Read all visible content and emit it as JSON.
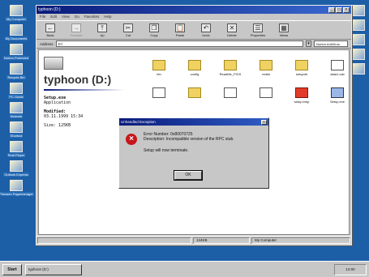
{
  "desktop": {
    "left_icons": [
      {
        "label": "My Computer",
        "icon": "computer-icon"
      },
      {
        "label": "My Documents",
        "icon": "documents-icon"
      },
      {
        "label": "Norton Protected",
        "icon": "norton-icon"
      },
      {
        "label": "Recycle Bin",
        "icon": "recycle-bin-icon"
      },
      {
        "label": "PC Guide",
        "icon": "guide-icon"
      },
      {
        "label": "Network",
        "icon": "network-icon"
      },
      {
        "label": "Shortcut",
        "icon": "shortcut-icon"
      },
      {
        "label": "Real Player",
        "icon": "player-icon"
      },
      {
        "label": "Outlook Express",
        "icon": "mail-icon"
      },
      {
        "label": "Pinnacle Pagemanager",
        "icon": "pagemanager-icon"
      }
    ],
    "right_icons": [
      {
        "label": "",
        "icon": "app-icon"
      },
      {
        "label": "",
        "icon": "app-icon"
      },
      {
        "label": "",
        "icon": "app-icon"
      },
      {
        "label": "",
        "icon": "app-icon"
      },
      {
        "label": "",
        "icon": "app-icon"
      }
    ]
  },
  "window": {
    "title": "typhoon (D:)",
    "menu": [
      "File",
      "Edit",
      "View",
      "Go",
      "Favorites",
      "Help"
    ],
    "toolbar": [
      {
        "label": "Back",
        "glyph": "←",
        "icon": "back-arrow-icon",
        "enabled": true
      },
      {
        "label": "Forward",
        "glyph": "→",
        "icon": "forward-arrow-icon",
        "enabled": false
      },
      {
        "label": "Up",
        "glyph": "⤒",
        "icon": "up-folder-icon",
        "enabled": true
      },
      {
        "label": "Cut",
        "glyph": "✂",
        "icon": "scissors-icon",
        "enabled": true
      },
      {
        "label": "Copy",
        "glyph": "❐",
        "icon": "copy-icon",
        "enabled": true
      },
      {
        "label": "Paste",
        "glyph": "📋",
        "icon": "paste-icon",
        "enabled": true
      },
      {
        "label": "Undo",
        "glyph": "↶",
        "icon": "undo-icon",
        "enabled": true
      },
      {
        "label": "Delete",
        "glyph": "✕",
        "icon": "delete-icon",
        "enabled": true
      },
      {
        "label": "Properties",
        "glyph": "☰",
        "icon": "properties-icon",
        "enabled": true
      },
      {
        "label": "Views",
        "glyph": "▦",
        "icon": "views-icon",
        "enabled": true
      }
    ],
    "address": {
      "label": "Address",
      "value": "D:\\",
      "extra": "Norton AntiVirus"
    },
    "webview": {
      "drive_title": "typhoon (D:)",
      "file_name": "Setup.exe",
      "file_type": "Application",
      "modified_label": "Modified:",
      "modified_value": "03.11.1999 15:34",
      "size_label": "Size: 125KB"
    },
    "files": [
      {
        "label": "bin",
        "kind": "folder"
      },
      {
        "label": "config",
        "kind": "folder"
      },
      {
        "label": "ReadMe_FIGS",
        "kind": "folder"
      },
      {
        "label": "redist",
        "kind": "folder"
      },
      {
        "label": "setupdir",
        "kind": "folder"
      },
      {
        "label": "data1.cab",
        "kind": "doc"
      },
      {
        "label": "",
        "kind": "doc"
      },
      {
        "label": "",
        "kind": "folder"
      },
      {
        "label": "",
        "kind": "doc"
      },
      {
        "label": "",
        "kind": "doc"
      },
      {
        "label": "setup.bmp",
        "kind": "setupbmp"
      },
      {
        "label": "Setup.exe",
        "kind": "exe"
      }
    ],
    "status": {
      "size": "124KB",
      "zone": "My Computer"
    }
  },
  "dialog": {
    "title": "Unhandled Exception",
    "close_glyph": "×",
    "error_number": "Error Number: 0x80070725",
    "description": "Description: Incompatible version of the RPC stub.",
    "message": "Setup will now terminate.",
    "ok_label": "OK"
  },
  "taskbar": {
    "start": "Start",
    "task": "typhoon (D:)",
    "tray": "12:00"
  }
}
